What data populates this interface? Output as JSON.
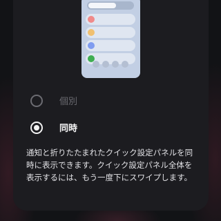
{
  "options": [
    {
      "label": "個別",
      "selected": false
    },
    {
      "label": "同時",
      "selected": true
    }
  ],
  "description": "通知と折りたたまれたクイック設定パネルを同時に表示できます。クイック設定パネル全体を表示するには、もう一度下にスワイプします。",
  "preview": {
    "row_colors": [
      "#f08a8a",
      "#f0c070",
      "#7f9cf0",
      "#3fae52"
    ]
  }
}
